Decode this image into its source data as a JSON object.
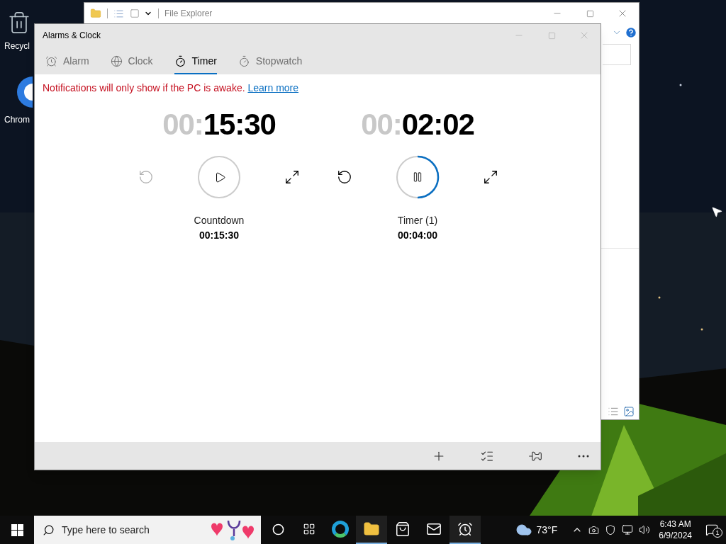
{
  "desktop": {
    "icons": [
      {
        "kind": "recycle",
        "label": "Recycl"
      },
      {
        "kind": "chrome",
        "label": "Chrom"
      }
    ]
  },
  "file_explorer": {
    "title": "File Explorer"
  },
  "window": {
    "title": "Alarms & Clock"
  },
  "tabs": [
    {
      "kind": "alarm",
      "label": "Alarm",
      "selected": false
    },
    {
      "kind": "clock",
      "label": "Clock",
      "selected": false
    },
    {
      "kind": "timer",
      "label": "Timer",
      "selected": true
    },
    {
      "kind": "stopwatch",
      "label": "Stopwatch",
      "selected": false
    }
  ],
  "notice": {
    "text": "Notifications will only show if the PC is awake.",
    "link": "Learn more"
  },
  "timers": [
    {
      "dim": "00:",
      "time": "15:30",
      "name": "Countdown",
      "duration": "00:15:30",
      "running": false,
      "reset_disabled": true
    },
    {
      "dim": "00:",
      "time": "02:02",
      "name": "Timer (1)",
      "duration": "00:04:00",
      "running": true,
      "reset_disabled": false
    }
  ],
  "toolbar": [
    {
      "kind": "add"
    },
    {
      "kind": "select"
    },
    {
      "kind": "pin"
    },
    {
      "kind": "more"
    }
  ],
  "taskbar": {
    "search_placeholder": "Type here to search",
    "apps": [
      {
        "kind": "cortana",
        "active": false
      },
      {
        "kind": "taskview",
        "active": false
      },
      {
        "kind": "edge",
        "active": false
      },
      {
        "kind": "explorer",
        "active": true
      },
      {
        "kind": "store",
        "active": false
      },
      {
        "kind": "mail",
        "active": false
      },
      {
        "kind": "alarms",
        "active": true
      }
    ],
    "weather": "73°F",
    "time": "6:43 AM",
    "date": "6/9/2024",
    "notifications": "1"
  }
}
